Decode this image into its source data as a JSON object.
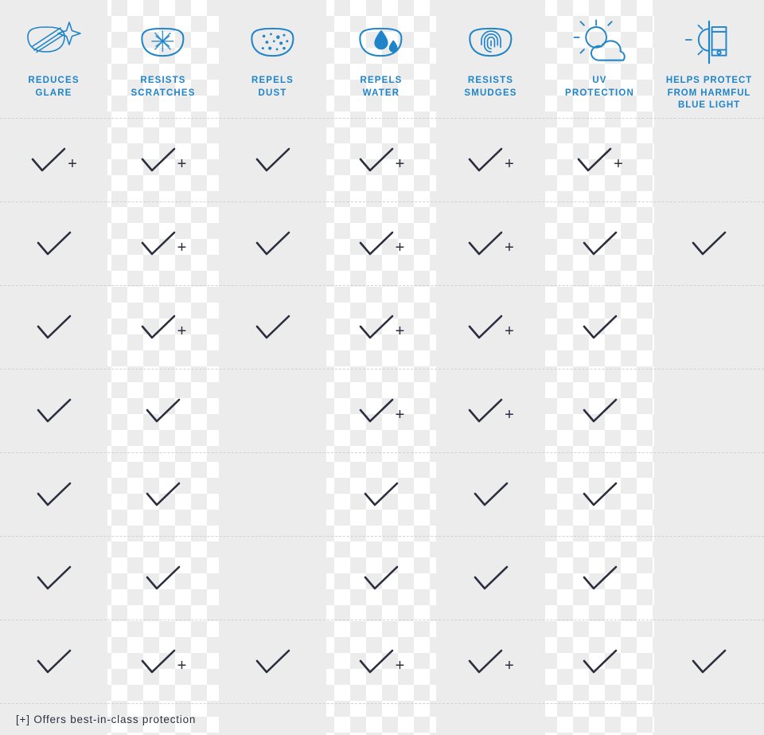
{
  "accent_color": "#1f84c8",
  "mark_color": "#2b2e3f",
  "band_color": "#ececec",
  "columns": [
    {
      "id": "reduces-glare",
      "label": "REDUCES\nGLARE",
      "icon": "lens-sparkle-icon",
      "banded": true
    },
    {
      "id": "resists-scratches",
      "label": "RESISTS\nSCRATCHES",
      "icon": "lens-scratch-icon",
      "banded": false
    },
    {
      "id": "repels-dust",
      "label": "REPELS\nDUST",
      "icon": "lens-dust-icon",
      "banded": true
    },
    {
      "id": "repels-water",
      "label": "REPELS\nWATER",
      "icon": "lens-water-drop-icon",
      "banded": false
    },
    {
      "id": "resists-smudges",
      "label": "RESISTS\nSMUDGES",
      "icon": "lens-fingerprint-icon",
      "banded": true
    },
    {
      "id": "uv-protection",
      "label": "UV\nPROTECTION",
      "icon": "sun-cloud-icon",
      "banded": false
    },
    {
      "id": "blue-light",
      "label": "HELPS PROTECT\nFROM HARMFUL\nBLUE LIGHT",
      "icon": "sun-phone-icon",
      "banded": true
    }
  ],
  "rows": [
    {
      "id": "row-1",
      "cells": [
        "check-plus",
        "check-plus",
        "check",
        "check-plus",
        "check-plus",
        "check-plus",
        "none"
      ]
    },
    {
      "id": "row-2",
      "cells": [
        "check",
        "check-plus",
        "check",
        "check-plus",
        "check-plus",
        "check",
        "check"
      ]
    },
    {
      "id": "row-3",
      "cells": [
        "check",
        "check-plus",
        "check",
        "check-plus",
        "check-plus",
        "check",
        "none"
      ]
    },
    {
      "id": "row-4",
      "cells": [
        "check",
        "check",
        "none",
        "check-plus",
        "check-plus",
        "check",
        "none"
      ]
    },
    {
      "id": "row-5",
      "cells": [
        "check",
        "check",
        "none",
        "check",
        "check",
        "check",
        "none"
      ]
    },
    {
      "id": "row-6",
      "cells": [
        "check",
        "check",
        "none",
        "check",
        "check",
        "check",
        "none"
      ]
    },
    {
      "id": "row-7",
      "cells": [
        "check",
        "check-plus",
        "check",
        "check-plus",
        "check-plus",
        "check",
        "check"
      ]
    }
  ],
  "footnote": "[+] Offers best-in-class protection",
  "plus_glyph": "+"
}
